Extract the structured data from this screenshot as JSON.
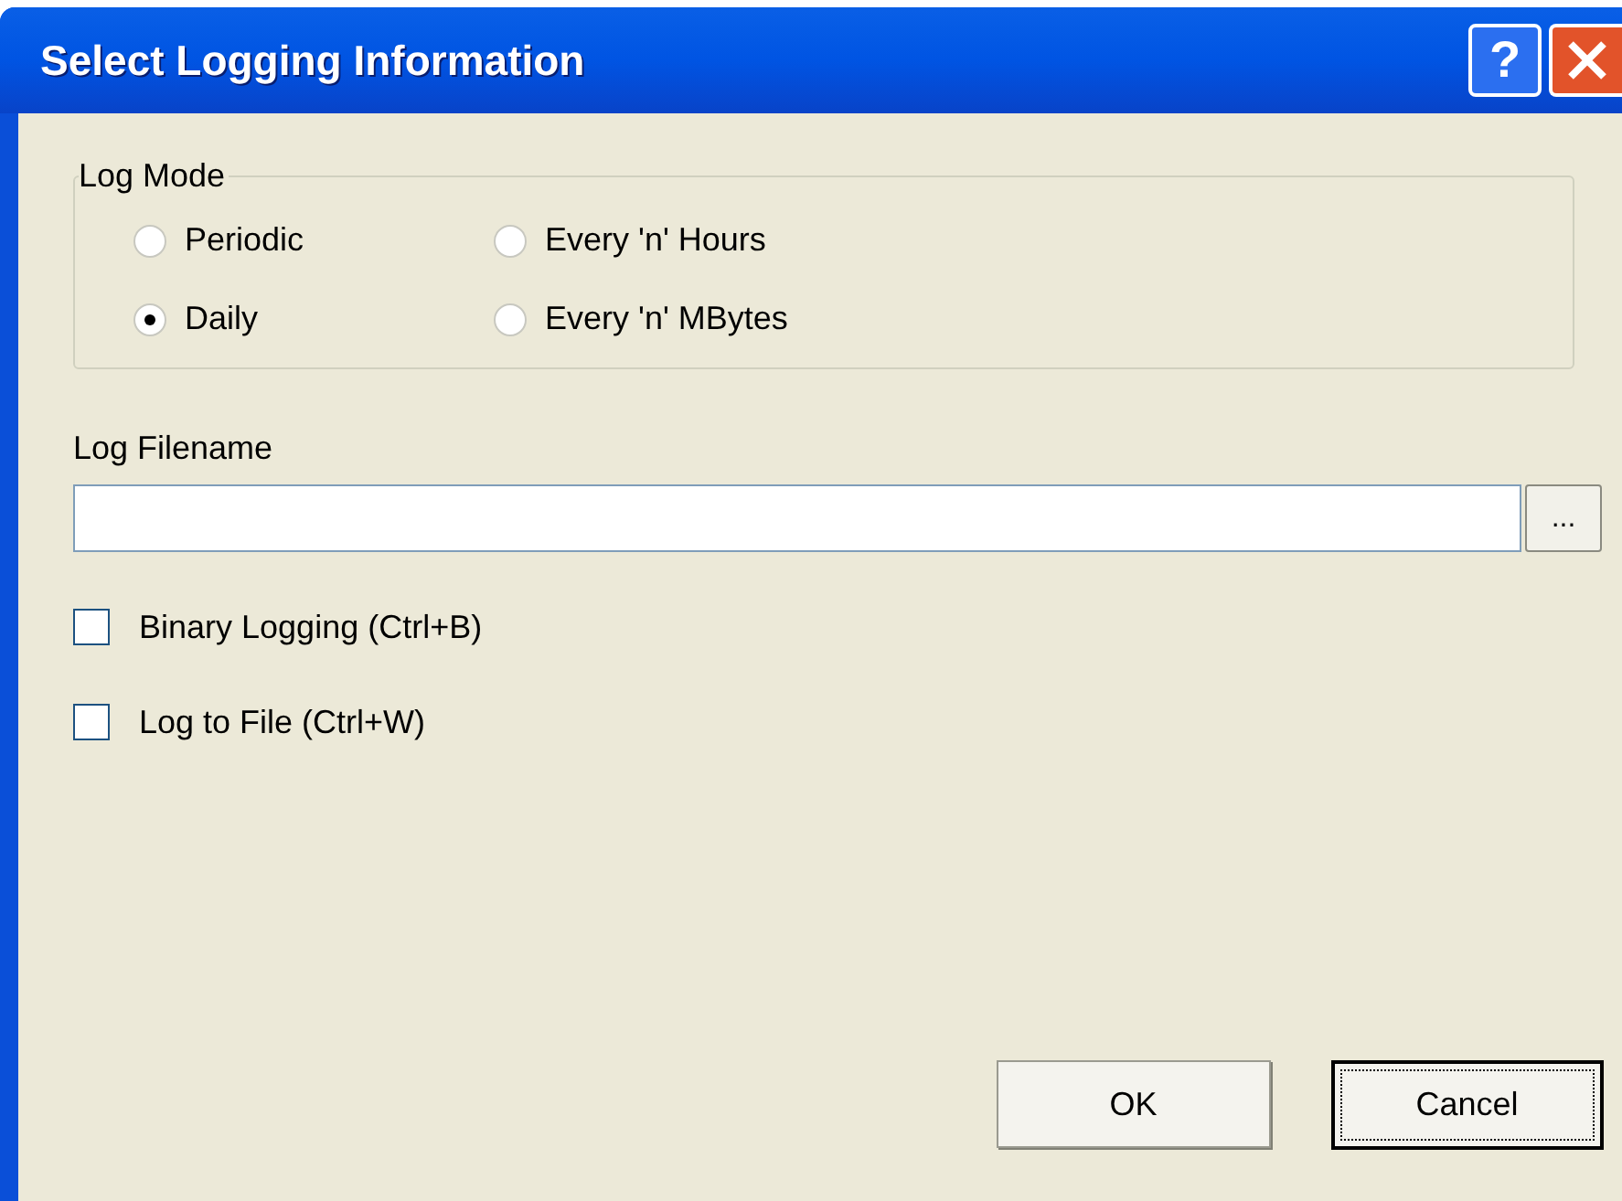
{
  "window": {
    "title": "Select Logging Information",
    "help_button": "?"
  },
  "log_mode": {
    "label": "Log Mode",
    "options": [
      {
        "label": "Periodic",
        "selected": false
      },
      {
        "label": "Every 'n' Hours",
        "selected": false
      },
      {
        "label": "Daily",
        "selected": true
      },
      {
        "label": "Every 'n' MBytes",
        "selected": false
      }
    ]
  },
  "log_filename": {
    "label": "Log Filename",
    "browse_button": "..."
  },
  "checkboxes": [
    {
      "label": "Binary Logging (Ctrl+B)",
      "checked": false
    },
    {
      "label": "Log to File (Ctrl+W)",
      "checked": false
    }
  ],
  "buttons": [
    {
      "label": "OK",
      "default": false
    },
    {
      "label": "Cancel",
      "default": true
    }
  ]
}
